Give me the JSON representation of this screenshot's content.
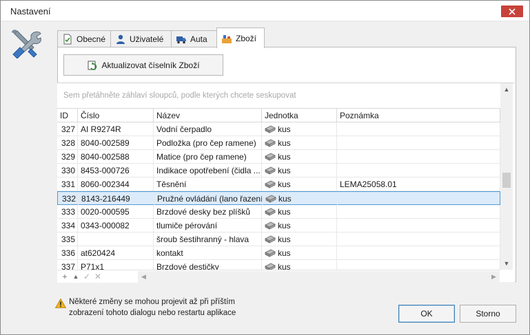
{
  "window": {
    "title": "Nastavení"
  },
  "tabs": [
    {
      "label": "Obecné",
      "icon": "document-check-icon"
    },
    {
      "label": "Uživatelé",
      "icon": "user-icon"
    },
    {
      "label": "Auta",
      "icon": "truck-icon"
    },
    {
      "label": "Zboží",
      "icon": "goods-icon",
      "active": true
    }
  ],
  "toolbar": {
    "update_label": "Aktualizovat číselník Zboží"
  },
  "grid": {
    "group_hint": "Sem přetáhněte záhlaví sloupců, podle kterých chcete seskupovat",
    "columns": [
      "ID",
      "Číslo",
      "Název",
      "Jednotka",
      "Poznámka"
    ],
    "rows": [
      {
        "id": "327",
        "cislo": "AI R9274R",
        "nazev": "Vodní čerpadlo",
        "jednotka": "kus",
        "poznamka": ""
      },
      {
        "id": "328",
        "cislo": "8040-002589",
        "nazev": "Podložka (pro čep ramene)",
        "jednotka": "kus",
        "poznamka": ""
      },
      {
        "id": "329",
        "cislo": "8040-002588",
        "nazev": "Matice (pro čep ramene)",
        "jednotka": "kus",
        "poznamka": ""
      },
      {
        "id": "330",
        "cislo": "8453-000726",
        "nazev": "Indikace opotřebení (čidla ...",
        "jednotka": "kus",
        "poznamka": ""
      },
      {
        "id": "331",
        "cislo": "8060-002344",
        "nazev": "Těsnění",
        "jednotka": "kus",
        "poznamka": "LEMA25058.01"
      },
      {
        "id": "332",
        "cislo": "8143-216449",
        "nazev": "Pružné ovládání (lano řazení)",
        "jednotka": "kus",
        "poznamka": "",
        "selected": true
      },
      {
        "id": "333",
        "cislo": "0020-000595",
        "nazev": "Brzdové desky bez plíšků",
        "jednotka": "kus",
        "poznamka": ""
      },
      {
        "id": "334",
        "cislo": "0343-000082",
        "nazev": "tlumiče pérování",
        "jednotka": "kus",
        "poznamka": ""
      },
      {
        "id": "335",
        "cislo": "",
        "nazev": "šroub šestihranný - hlava",
        "jednotka": "kus",
        "poznamka": ""
      },
      {
        "id": "336",
        "cislo": "at620424",
        "nazev": "kontakt",
        "jednotka": "kus",
        "poznamka": ""
      },
      {
        "id": "337",
        "cislo": "P71x1",
        "nazev": "Brzdové destičky",
        "jednotka": "kus",
        "poznamka": ""
      }
    ]
  },
  "footer": {
    "warning_line1": "Některé změny se mohou projevit až při příštím",
    "warning_line2": "zobrazení tohoto dialogu nebo restartu aplikace",
    "ok_label": "OK",
    "cancel_label": "Storno"
  },
  "colors": {
    "accent": "#4f9ad8",
    "selected_row": "#dcebfa",
    "close": "#c7423a"
  }
}
